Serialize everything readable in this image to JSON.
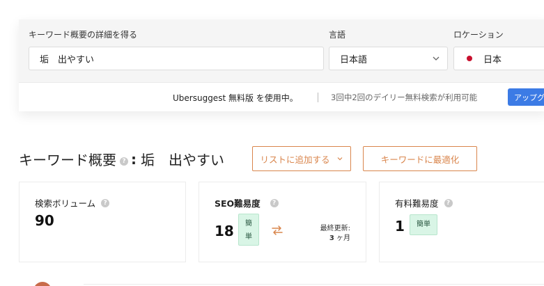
{
  "search": {
    "keyword_label": "キーワード概要の詳細を得る",
    "keyword_value": "垢　出やすい",
    "language_label": "言語",
    "language_value": "日本語",
    "location_label": "ロケーション",
    "location_value": "日本"
  },
  "promo": {
    "free_text": "Ubersuggest 無料版 を使用中。",
    "count_text": "3回中2回のデイリー無料検索が利用可能",
    "upgrade_label": "アップグレード"
  },
  "overview": {
    "title": "キーワード概要",
    "keyword": "垢　出やすい",
    "add_list_label": "リストに追加する",
    "optimize_label": "キーワードに最適化"
  },
  "cards": {
    "volume": {
      "label": "検索ボリューム",
      "value": "90"
    },
    "seo": {
      "label": "SEO難易度",
      "value": "18",
      "badge": "簡単",
      "updated_label": "最終更新:",
      "updated_num": "3",
      "updated_unit": "ヶ月"
    },
    "paid": {
      "label": "有料難易度",
      "value": "1",
      "badge": "簡単"
    }
  },
  "colors": {
    "accent": "#d9854c",
    "upgrade": "#3c7be5",
    "easy_badge": "#d9f5e6",
    "flag": "#c8102e"
  },
  "icons": {
    "help": "help-icon",
    "refresh": "refresh-icon",
    "chevron": "chevron-down-icon"
  }
}
